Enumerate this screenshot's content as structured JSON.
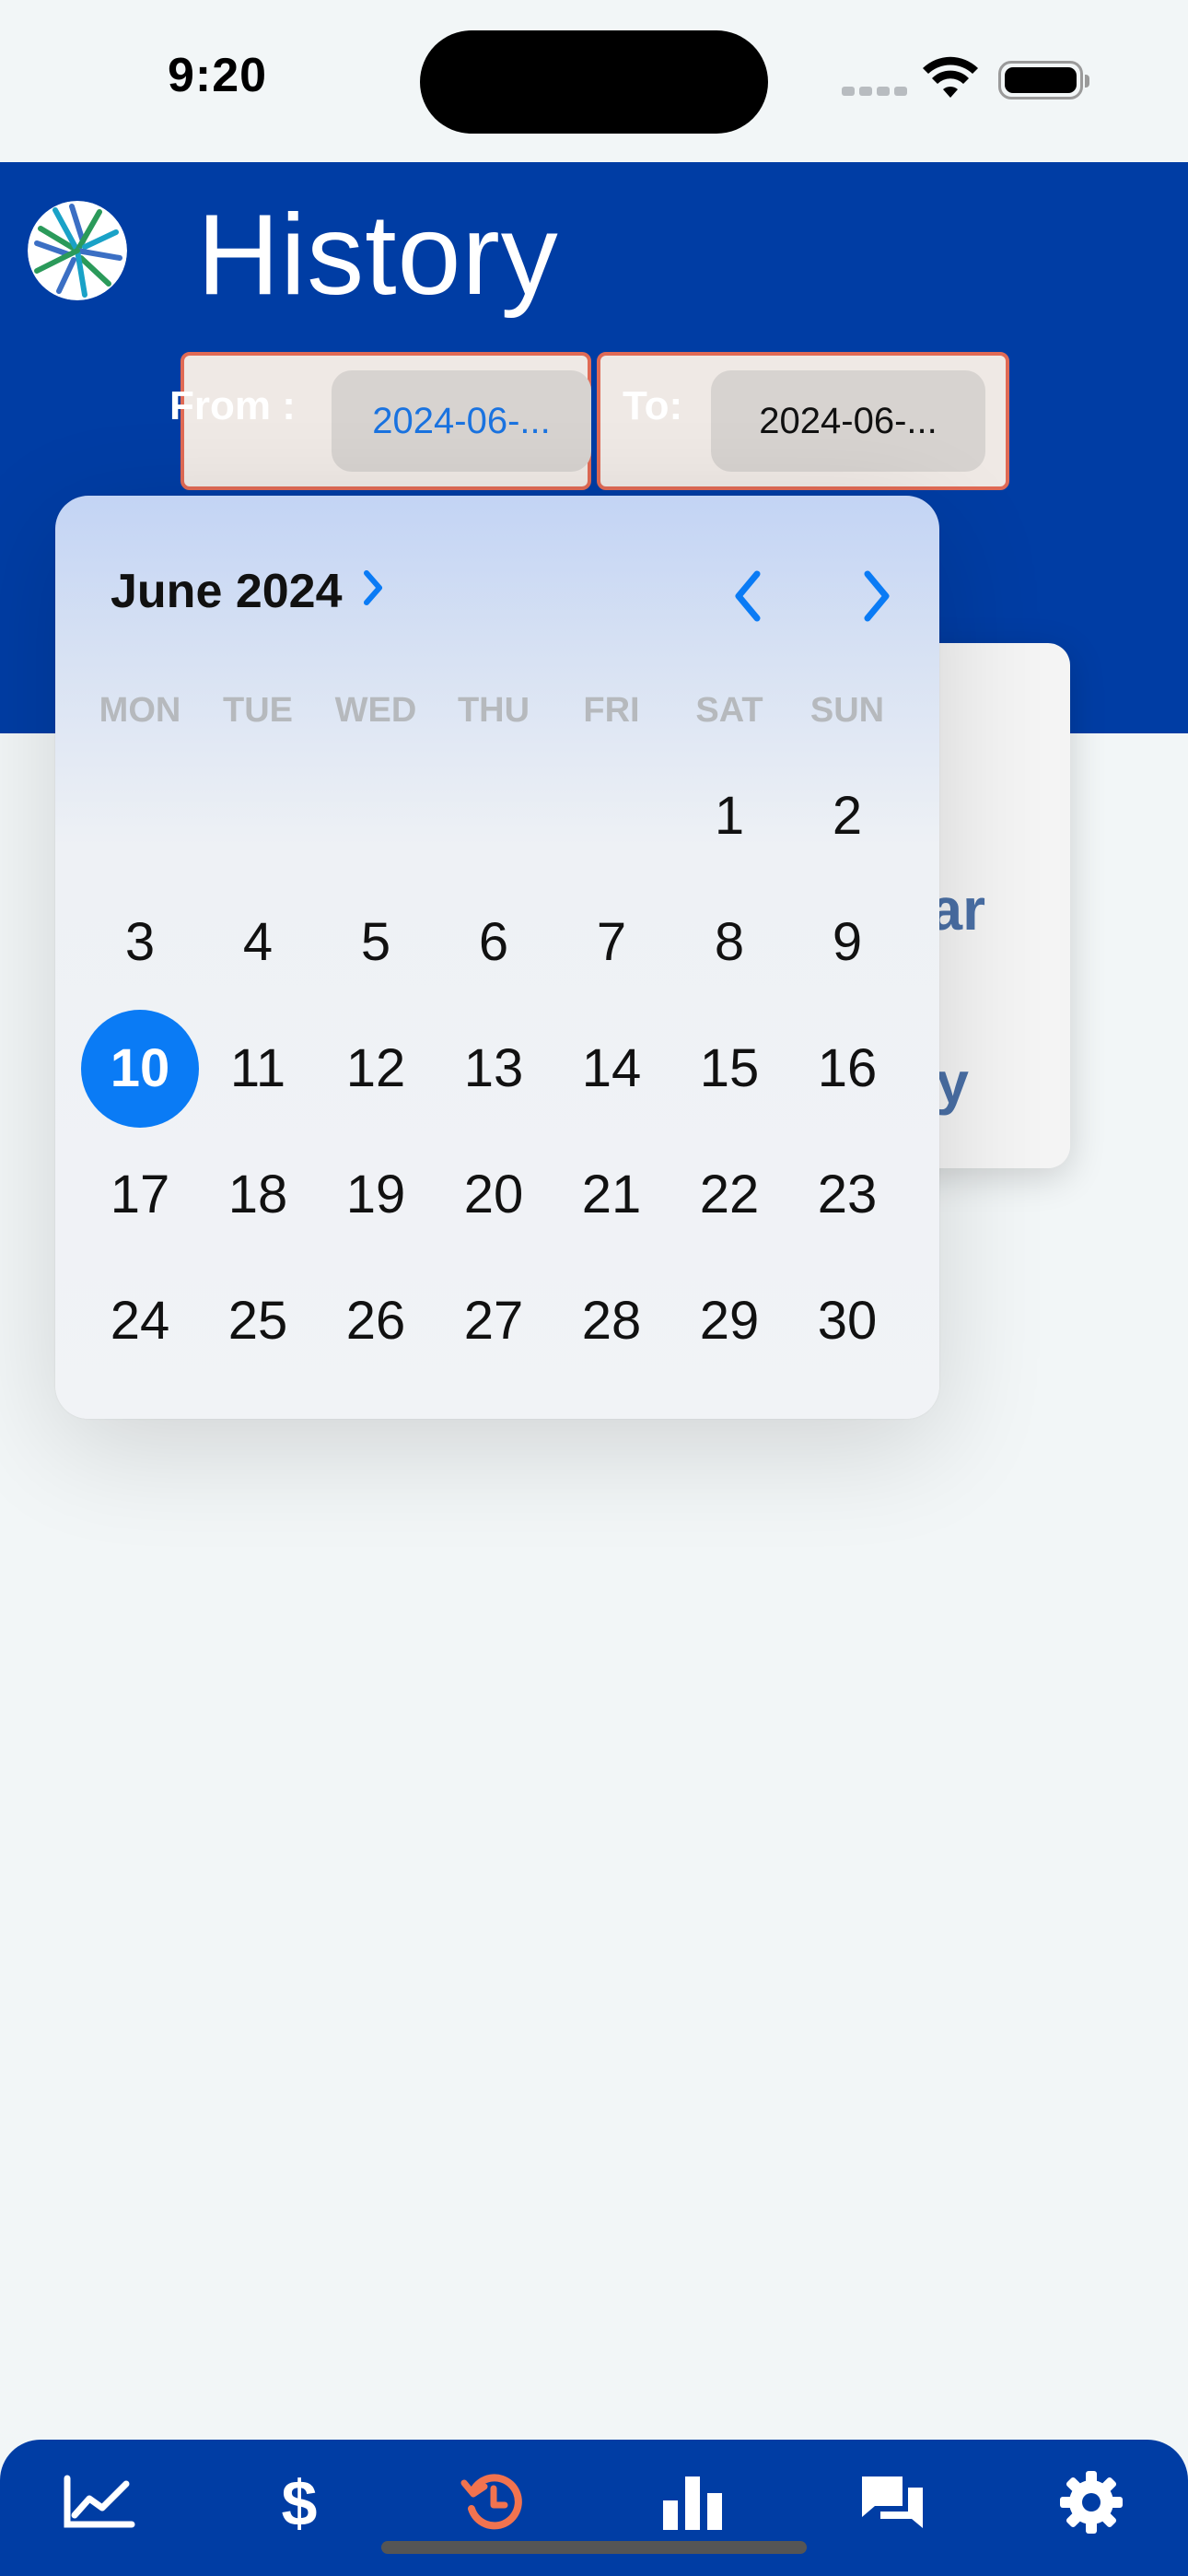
{
  "status_bar": {
    "time": "9:20"
  },
  "header": {
    "title": "History",
    "from": {
      "label": "From :",
      "value": "2024-06-..."
    },
    "to": {
      "label": "To:",
      "value": "2024-06-..."
    }
  },
  "background_card": {
    "text1": "ar",
    "text2": "y"
  },
  "calendar": {
    "month_label": "June 2024",
    "weekdays": [
      "MON",
      "TUE",
      "WED",
      "THU",
      "FRI",
      "SAT",
      "SUN"
    ],
    "first_weekday_index": 5,
    "days": [
      "1",
      "2",
      "3",
      "4",
      "5",
      "6",
      "7",
      "8",
      "9",
      "10",
      "11",
      "12",
      "13",
      "14",
      "15",
      "16",
      "17",
      "18",
      "19",
      "20",
      "21",
      "22",
      "23",
      "24",
      "25",
      "26",
      "27",
      "28",
      "29",
      "30"
    ],
    "selected_day": "10",
    "accent_color": "#0a7bf5"
  },
  "bottom_nav": {
    "items": [
      {
        "icon": "trending-chart-icon",
        "active": false
      },
      {
        "icon": "dollar-icon",
        "active": false
      },
      {
        "icon": "history-icon",
        "active": true
      },
      {
        "icon": "bar-chart-icon",
        "active": false
      },
      {
        "icon": "chat-icon",
        "active": false
      },
      {
        "icon": "settings-gear-icon",
        "active": false
      }
    ],
    "active_color": "#f2734f",
    "color": "#ffffff"
  },
  "colors": {
    "brand_blue": "#003da4",
    "date_border": "#e06a55"
  }
}
